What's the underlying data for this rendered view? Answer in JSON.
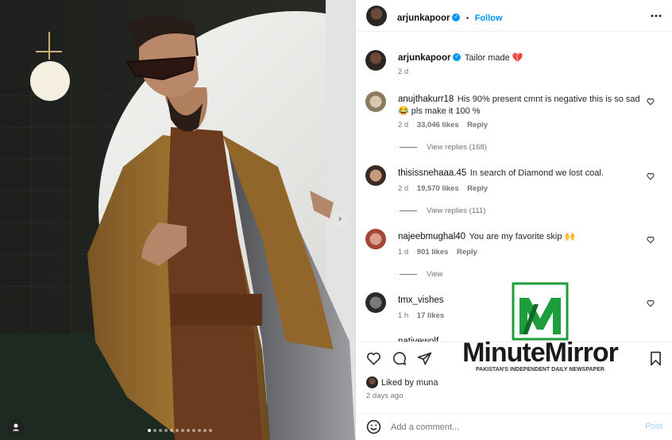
{
  "post": {
    "username": "arjunkapoor",
    "follow_label": "Follow",
    "separator": "•",
    "caption": "Tailor made 💔",
    "caption_time": "2 d"
  },
  "comments": [
    {
      "user": "anujthakurr18",
      "text": "His 90% present cmnt is negative this is so sad 😂 pls make it 100 %",
      "time": "2 d",
      "likes": "33,046 likes",
      "reply": "Reply",
      "view_replies": "View replies (168)"
    },
    {
      "user": "thisissnehaaa.45",
      "text": "In search of Diamond we lost coal.",
      "time": "2 d",
      "likes": "19,570 likes",
      "reply": "Reply",
      "view_replies": "View replies (111)"
    },
    {
      "user": "najeebmughal40",
      "text": "You are my favorite skip 🙌",
      "time": "1 d",
      "likes": "901 likes",
      "reply": "Reply",
      "view_replies": "View"
    },
    {
      "user": "tmx_vishes",
      "text": "",
      "time": "1 h",
      "likes": "17 likes",
      "reply": "",
      "view_replies": ""
    },
    {
      "user": "nativewolf",
      "text": "",
      "time": "",
      "likes": "",
      "reply": "",
      "view_replies": ""
    }
  ],
  "liked_by": "Liked by muna",
  "date": "2 days ago",
  "add_comment": {
    "placeholder": "Add a comment...",
    "post_label": "Post"
  },
  "watermark": {
    "name": "MinuteMirror",
    "tagline": "PAKISTAN'S INDEPENDENT DAILY NEWSPAPER",
    "brand_green": "#1e9e3a"
  },
  "carousel": {
    "total": 12,
    "active_index": 0
  },
  "icons": [
    "verified-badge-icon",
    "more-options-icon",
    "heart-icon",
    "comment-icon",
    "share-icon",
    "bookmark-icon",
    "emoji-icon",
    "next-arrow-icon",
    "user-tag-icon"
  ]
}
